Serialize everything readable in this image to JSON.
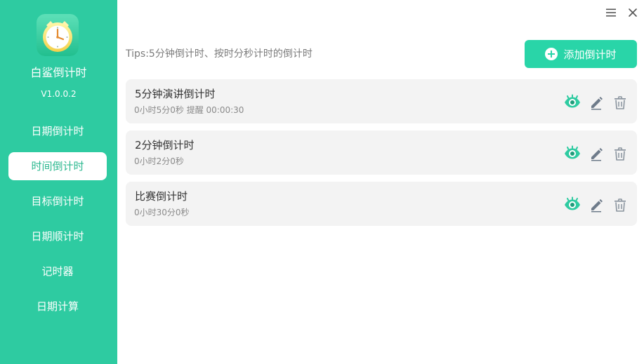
{
  "app": {
    "name": "白鲨倒计时",
    "version": "V1.0.0.2",
    "accent_color": "#2ecba1",
    "button_color": "#29d5a8"
  },
  "sidebar": {
    "items": [
      {
        "label": "日期倒计时",
        "active": false
      },
      {
        "label": "时间倒计时",
        "active": true
      },
      {
        "label": "目标倒计时",
        "active": false
      },
      {
        "label": "日期顺计时",
        "active": false
      },
      {
        "label": "记时器",
        "active": false
      },
      {
        "label": "日期计算",
        "active": false
      }
    ]
  },
  "window_controls": {
    "menu_icon": "menu-icon",
    "close_icon": "close-icon"
  },
  "main": {
    "tips": "Tips:5分钟倒计时、按时分秒计时的倒计时",
    "add_button_label": "添加倒计时",
    "add_button_icon": "plus-circle-icon",
    "cards": [
      {
        "title": "5分钟演讲倒计时",
        "subtitle": "0小时5分0秒 提醒 00:00:30",
        "actions": [
          "eye-icon",
          "edit-icon",
          "trash-icon"
        ]
      },
      {
        "title": "2分钟倒计时",
        "subtitle": "0小时2分0秒",
        "actions": [
          "eye-icon",
          "edit-icon",
          "trash-icon"
        ]
      },
      {
        "title": "比赛倒计时",
        "subtitle": "0小时30分0秒",
        "actions": [
          "eye-icon",
          "edit-icon",
          "trash-icon"
        ]
      }
    ]
  }
}
